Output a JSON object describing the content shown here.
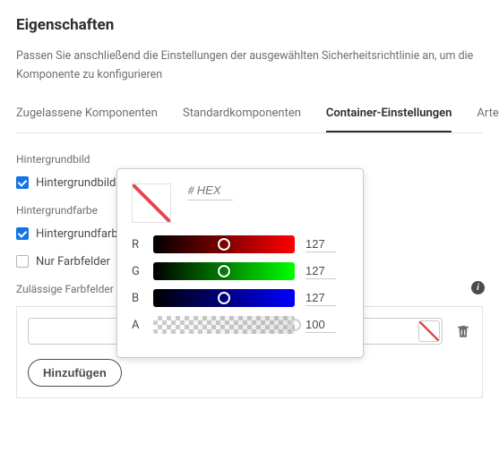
{
  "title": "Eigenschaften",
  "description": "Passen Sie anschließend die Einstellungen der ausgewählten Sicherheitsrichtlinie an, um die Komponente zu konfigurieren",
  "tabs": [
    {
      "label": "Zugelassene Komponenten",
      "active": false
    },
    {
      "label": "Standardkomponenten",
      "active": false
    },
    {
      "label": "Container-Einstellungen",
      "active": true
    },
    {
      "label": "Arten",
      "active": false
    }
  ],
  "bgimage": {
    "heading": "Hintergrundbild",
    "cb_label": "Hintergrundbild",
    "checked": true
  },
  "bgcolor": {
    "heading": "Hintergrundfarbe",
    "cb_label": "Hintergrundfarbe",
    "checked": true,
    "swatches_only_label": "Nur Farbfelder",
    "swatches_only_checked": false
  },
  "swatches": {
    "heading": "Zulässige Farbfelder",
    "add_label": "Hinzufügen"
  },
  "picker": {
    "hex_placeholder": "HEX",
    "channels": {
      "r": {
        "label": "R",
        "value": 127
      },
      "g": {
        "label": "G",
        "value": 127
      },
      "b": {
        "label": "B",
        "value": 127
      },
      "a": {
        "label": "A",
        "value": 100
      }
    }
  }
}
